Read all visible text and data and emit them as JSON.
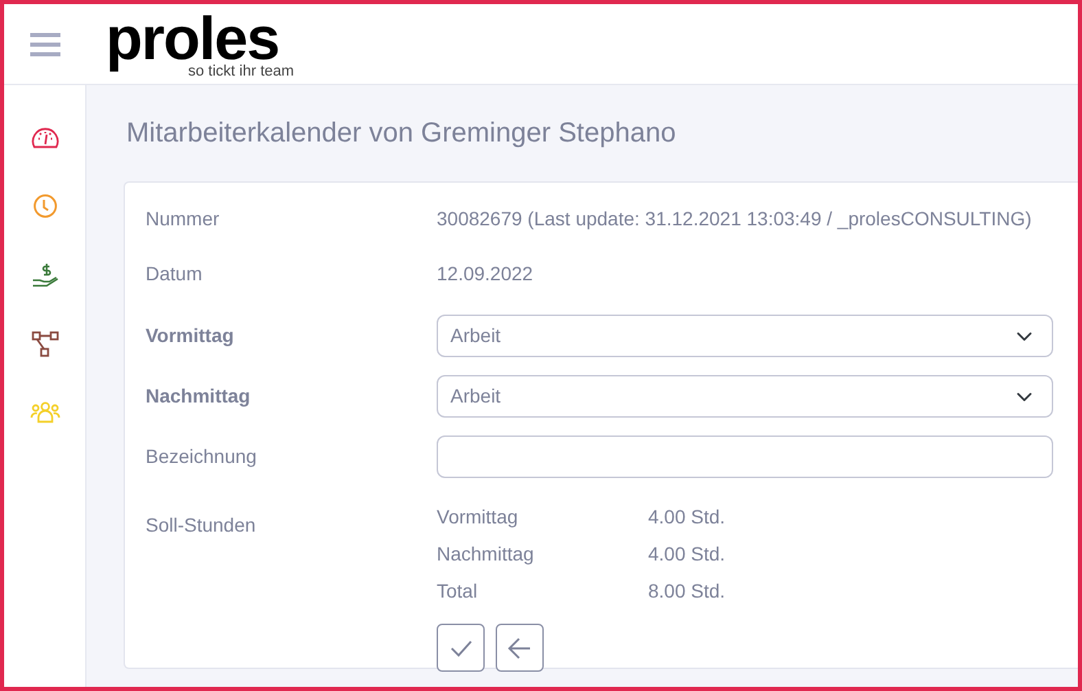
{
  "header": {
    "logo": "proles",
    "tagline": "so tickt ihr team"
  },
  "sidebar": {
    "items": [
      {
        "kind": "gauge"
      },
      {
        "kind": "clock"
      },
      {
        "kind": "money"
      },
      {
        "kind": "nodes"
      },
      {
        "kind": "team"
      }
    ]
  },
  "page_title": "Mitarbeiterkalender von Greminger Stephano",
  "form": {
    "rows": [
      {
        "kind": "text",
        "label": "Nummer",
        "value": "30082679 (Last update: 31.12.2021 13:03:49 / _prolesCONSULTING)",
        "required": false
      },
      {
        "kind": "text",
        "label": "Datum",
        "value": "12.09.2022",
        "required": false
      },
      {
        "kind": "select",
        "label": "Vormittag",
        "value": "Arbeit",
        "required": true
      },
      {
        "kind": "select",
        "label": "Nachmittag",
        "value": "Arbeit",
        "required": true
      },
      {
        "kind": "input",
        "label": "Bezeichnung",
        "required": false
      },
      {
        "kind": "hours",
        "label": "Soll-Stunden",
        "required": false,
        "items": [
          {
            "label": "Vormittag",
            "value": "4.00 Std."
          },
          {
            "label": "Nachmittag",
            "value": "4.00 Std."
          },
          {
            "label": "Total",
            "value": "8.00 Std."
          }
        ]
      }
    ],
    "buttons": [
      {
        "kind": "confirm"
      },
      {
        "kind": "back"
      }
    ]
  }
}
